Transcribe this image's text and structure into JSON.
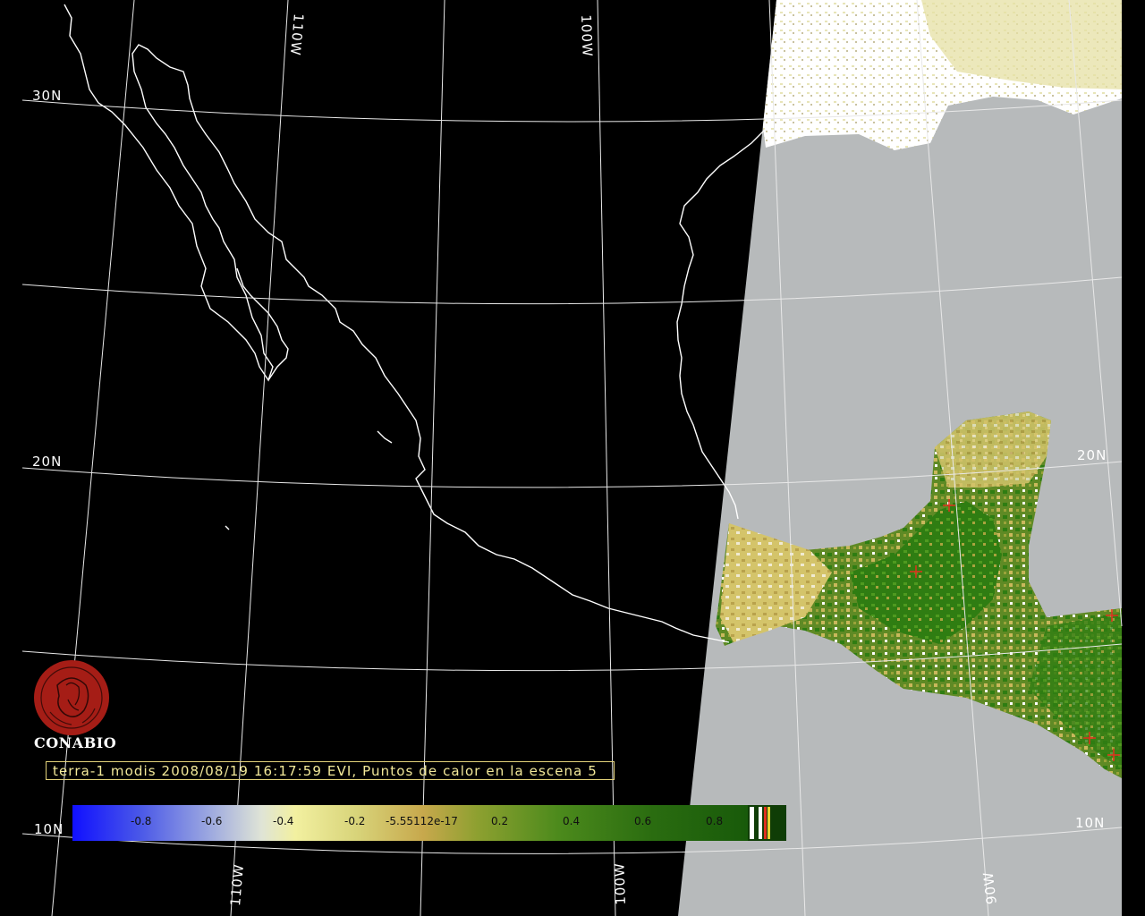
{
  "map": {
    "lat_labels": [
      "30N",
      "20N",
      "20N",
      "10N",
      "10N"
    ],
    "lon_labels": [
      "110W",
      "100W",
      "110W",
      "100W",
      "90W"
    ],
    "title": "terra-1 modis 2008/08/19 16:17:59 EVI, Puntos de calor en la escena 5",
    "logo_text": "CONABIO",
    "colorbar_ticks": [
      "-0.8",
      "-0.6",
      "-0.4",
      "-0.2",
      "-5.55112e-17",
      "0.2",
      "0.4",
      "0.6",
      "0.8"
    ],
    "colors": {
      "background": "#000000",
      "ocean": "#b7babb",
      "vegetation_high": "#2f7d12",
      "vegetation_low": "#c9b85c",
      "grid": "#ffffff",
      "hotspot": "#e0301e",
      "logo": "#a51d16",
      "caption": "#f3e99a"
    },
    "hotspots_count": 5
  }
}
